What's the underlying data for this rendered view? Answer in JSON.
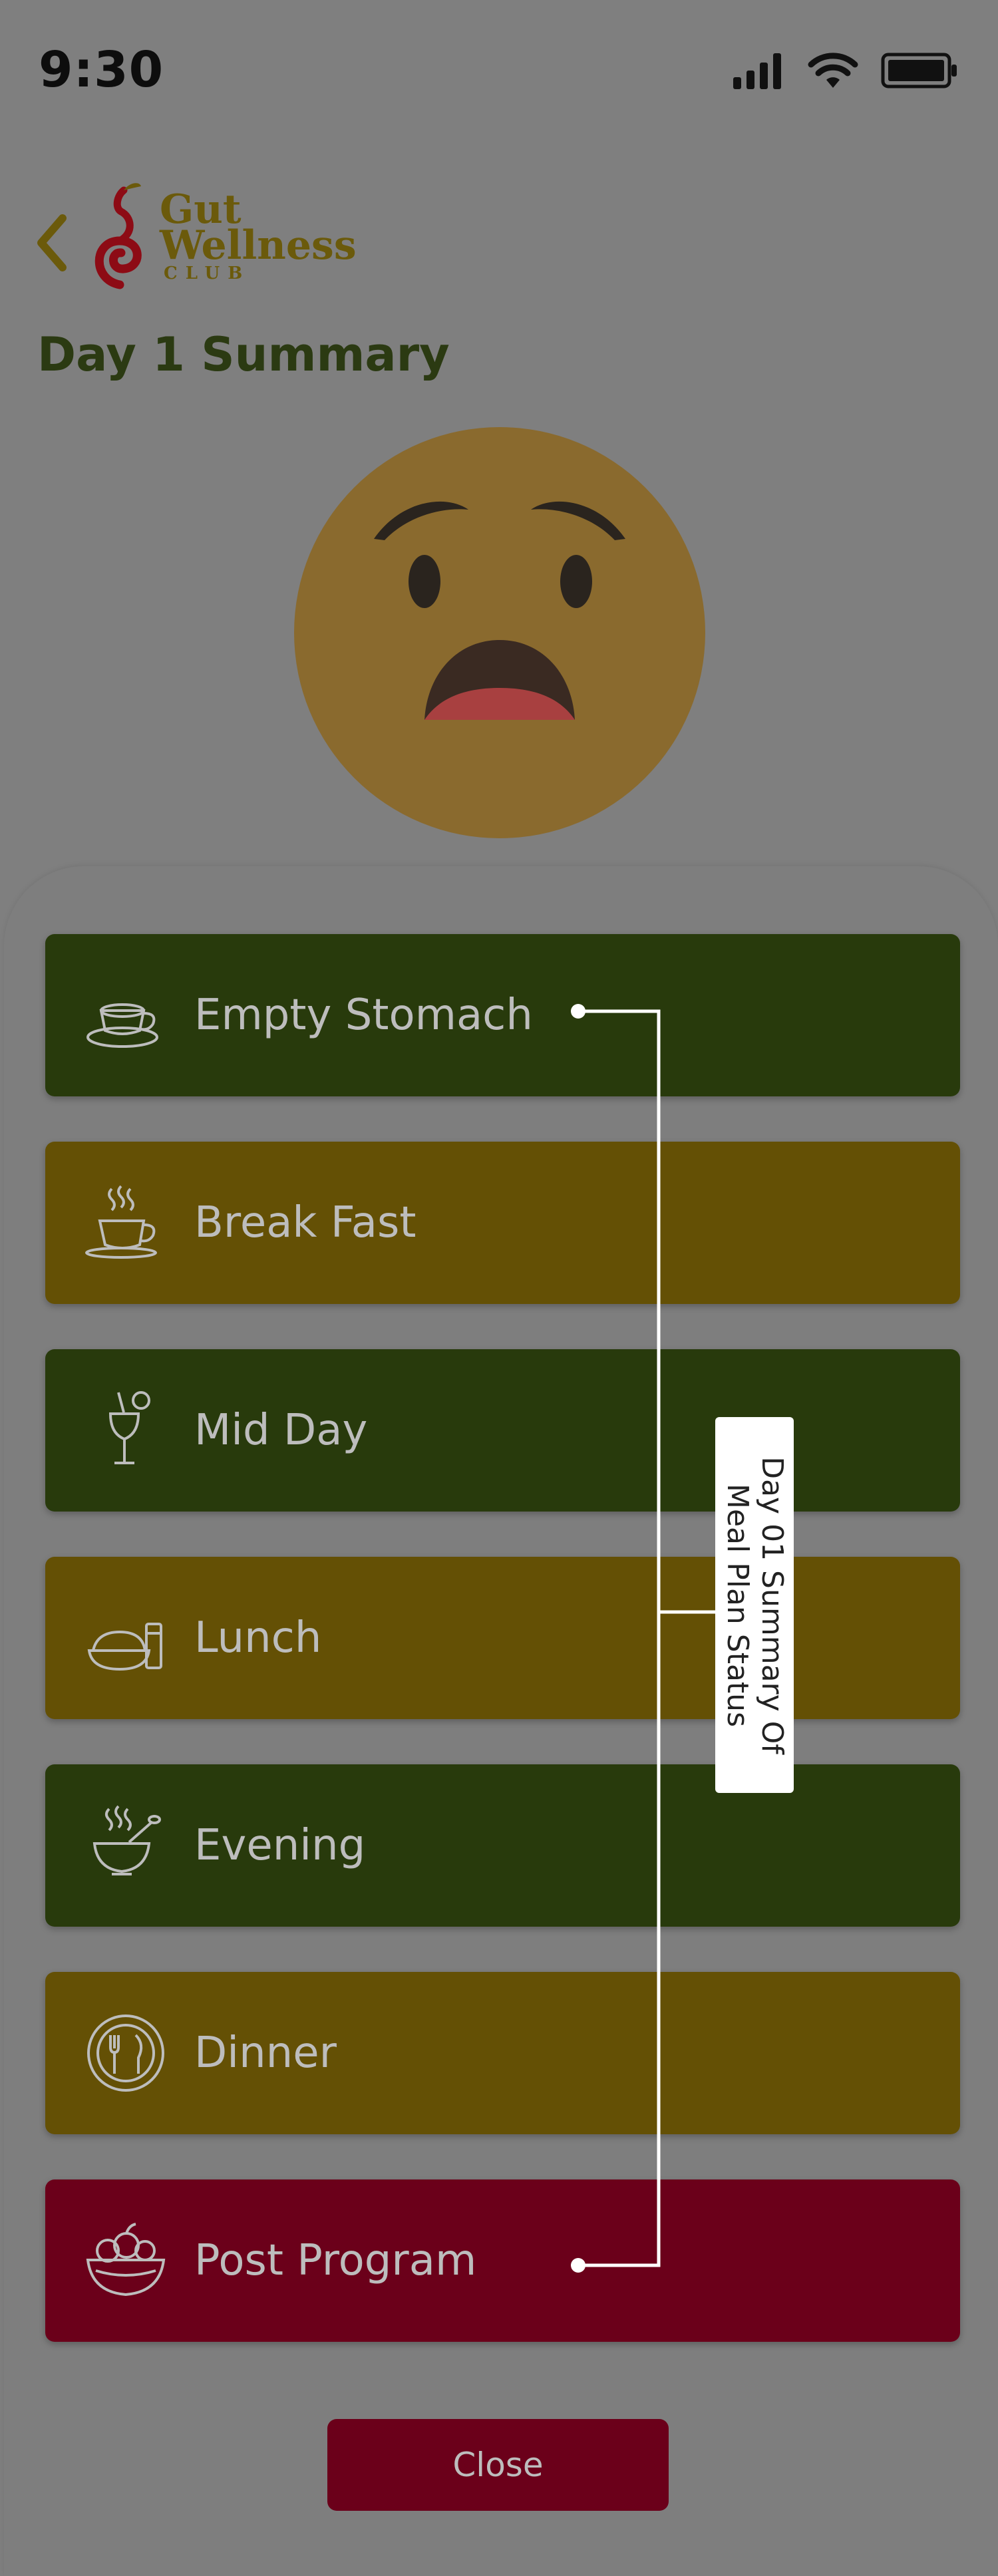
{
  "status_bar": {
    "time": "9:30"
  },
  "header": {
    "logo": {
      "line1": "Gut",
      "line2": "Wellness",
      "line3": "CLUB"
    },
    "title": "Day 1 Summary"
  },
  "mood": {
    "icon": "anguished-face-icon"
  },
  "meals": [
    {
      "label": "Empty Stomach",
      "icon": "tea-cup-icon",
      "status_color": "#283a0c"
    },
    {
      "label": "Break Fast",
      "icon": "hot-drink-icon",
      "status_color": "#645005"
    },
    {
      "label": "Mid Day",
      "icon": "juice-glass-icon",
      "status_color": "#283a0c"
    },
    {
      "label": "Lunch",
      "icon": "rice-bowl-icon",
      "status_color": "#645005"
    },
    {
      "label": "Evening",
      "icon": "soup-bowl-icon",
      "status_color": "#283a0c"
    },
    {
      "label": "Dinner",
      "icon": "plate-cutlery-icon",
      "status_color": "#645005"
    },
    {
      "label": "Post Program",
      "icon": "fruit-bowl-icon",
      "status_color": "#6b001a"
    }
  ],
  "annotation": {
    "text": "Day 01 Summary Of Meal Plan Status"
  },
  "close_label": "Close",
  "colors": {
    "green": "#283a0c",
    "gold": "#645005",
    "red": "#6b001a",
    "background": "#7f7f7f"
  }
}
